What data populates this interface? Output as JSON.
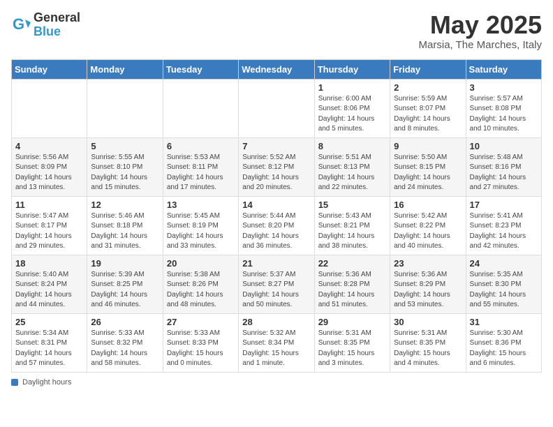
{
  "header": {
    "logo_general": "General",
    "logo_blue": "Blue",
    "month_title": "May 2025",
    "location": "Marsia, The Marches, Italy"
  },
  "weekdays": [
    "Sunday",
    "Monday",
    "Tuesday",
    "Wednesday",
    "Thursday",
    "Friday",
    "Saturday"
  ],
  "weeks": [
    [
      {
        "day": "",
        "info": ""
      },
      {
        "day": "",
        "info": ""
      },
      {
        "day": "",
        "info": ""
      },
      {
        "day": "",
        "info": ""
      },
      {
        "day": "1",
        "info": "Sunrise: 6:00 AM\nSunset: 8:06 PM\nDaylight: 14 hours\nand 5 minutes."
      },
      {
        "day": "2",
        "info": "Sunrise: 5:59 AM\nSunset: 8:07 PM\nDaylight: 14 hours\nand 8 minutes."
      },
      {
        "day": "3",
        "info": "Sunrise: 5:57 AM\nSunset: 8:08 PM\nDaylight: 14 hours\nand 10 minutes."
      }
    ],
    [
      {
        "day": "4",
        "info": "Sunrise: 5:56 AM\nSunset: 8:09 PM\nDaylight: 14 hours\nand 13 minutes."
      },
      {
        "day": "5",
        "info": "Sunrise: 5:55 AM\nSunset: 8:10 PM\nDaylight: 14 hours\nand 15 minutes."
      },
      {
        "day": "6",
        "info": "Sunrise: 5:53 AM\nSunset: 8:11 PM\nDaylight: 14 hours\nand 17 minutes."
      },
      {
        "day": "7",
        "info": "Sunrise: 5:52 AM\nSunset: 8:12 PM\nDaylight: 14 hours\nand 20 minutes."
      },
      {
        "day": "8",
        "info": "Sunrise: 5:51 AM\nSunset: 8:13 PM\nDaylight: 14 hours\nand 22 minutes."
      },
      {
        "day": "9",
        "info": "Sunrise: 5:50 AM\nSunset: 8:15 PM\nDaylight: 14 hours\nand 24 minutes."
      },
      {
        "day": "10",
        "info": "Sunrise: 5:48 AM\nSunset: 8:16 PM\nDaylight: 14 hours\nand 27 minutes."
      }
    ],
    [
      {
        "day": "11",
        "info": "Sunrise: 5:47 AM\nSunset: 8:17 PM\nDaylight: 14 hours\nand 29 minutes."
      },
      {
        "day": "12",
        "info": "Sunrise: 5:46 AM\nSunset: 8:18 PM\nDaylight: 14 hours\nand 31 minutes."
      },
      {
        "day": "13",
        "info": "Sunrise: 5:45 AM\nSunset: 8:19 PM\nDaylight: 14 hours\nand 33 minutes."
      },
      {
        "day": "14",
        "info": "Sunrise: 5:44 AM\nSunset: 8:20 PM\nDaylight: 14 hours\nand 36 minutes."
      },
      {
        "day": "15",
        "info": "Sunrise: 5:43 AM\nSunset: 8:21 PM\nDaylight: 14 hours\nand 38 minutes."
      },
      {
        "day": "16",
        "info": "Sunrise: 5:42 AM\nSunset: 8:22 PM\nDaylight: 14 hours\nand 40 minutes."
      },
      {
        "day": "17",
        "info": "Sunrise: 5:41 AM\nSunset: 8:23 PM\nDaylight: 14 hours\nand 42 minutes."
      }
    ],
    [
      {
        "day": "18",
        "info": "Sunrise: 5:40 AM\nSunset: 8:24 PM\nDaylight: 14 hours\nand 44 minutes."
      },
      {
        "day": "19",
        "info": "Sunrise: 5:39 AM\nSunset: 8:25 PM\nDaylight: 14 hours\nand 46 minutes."
      },
      {
        "day": "20",
        "info": "Sunrise: 5:38 AM\nSunset: 8:26 PM\nDaylight: 14 hours\nand 48 minutes."
      },
      {
        "day": "21",
        "info": "Sunrise: 5:37 AM\nSunset: 8:27 PM\nDaylight: 14 hours\nand 50 minutes."
      },
      {
        "day": "22",
        "info": "Sunrise: 5:36 AM\nSunset: 8:28 PM\nDaylight: 14 hours\nand 51 minutes."
      },
      {
        "day": "23",
        "info": "Sunrise: 5:36 AM\nSunset: 8:29 PM\nDaylight: 14 hours\nand 53 minutes."
      },
      {
        "day": "24",
        "info": "Sunrise: 5:35 AM\nSunset: 8:30 PM\nDaylight: 14 hours\nand 55 minutes."
      }
    ],
    [
      {
        "day": "25",
        "info": "Sunrise: 5:34 AM\nSunset: 8:31 PM\nDaylight: 14 hours\nand 57 minutes."
      },
      {
        "day": "26",
        "info": "Sunrise: 5:33 AM\nSunset: 8:32 PM\nDaylight: 14 hours\nand 58 minutes."
      },
      {
        "day": "27",
        "info": "Sunrise: 5:33 AM\nSunset: 8:33 PM\nDaylight: 15 hours\nand 0 minutes."
      },
      {
        "day": "28",
        "info": "Sunrise: 5:32 AM\nSunset: 8:34 PM\nDaylight: 15 hours\nand 1 minute."
      },
      {
        "day": "29",
        "info": "Sunrise: 5:31 AM\nSunset: 8:35 PM\nDaylight: 15 hours\nand 3 minutes."
      },
      {
        "day": "30",
        "info": "Sunrise: 5:31 AM\nSunset: 8:35 PM\nDaylight: 15 hours\nand 4 minutes."
      },
      {
        "day": "31",
        "info": "Sunrise: 5:30 AM\nSunset: 8:36 PM\nDaylight: 15 hours\nand 6 minutes."
      }
    ]
  ],
  "footer": {
    "label": "Daylight hours"
  }
}
